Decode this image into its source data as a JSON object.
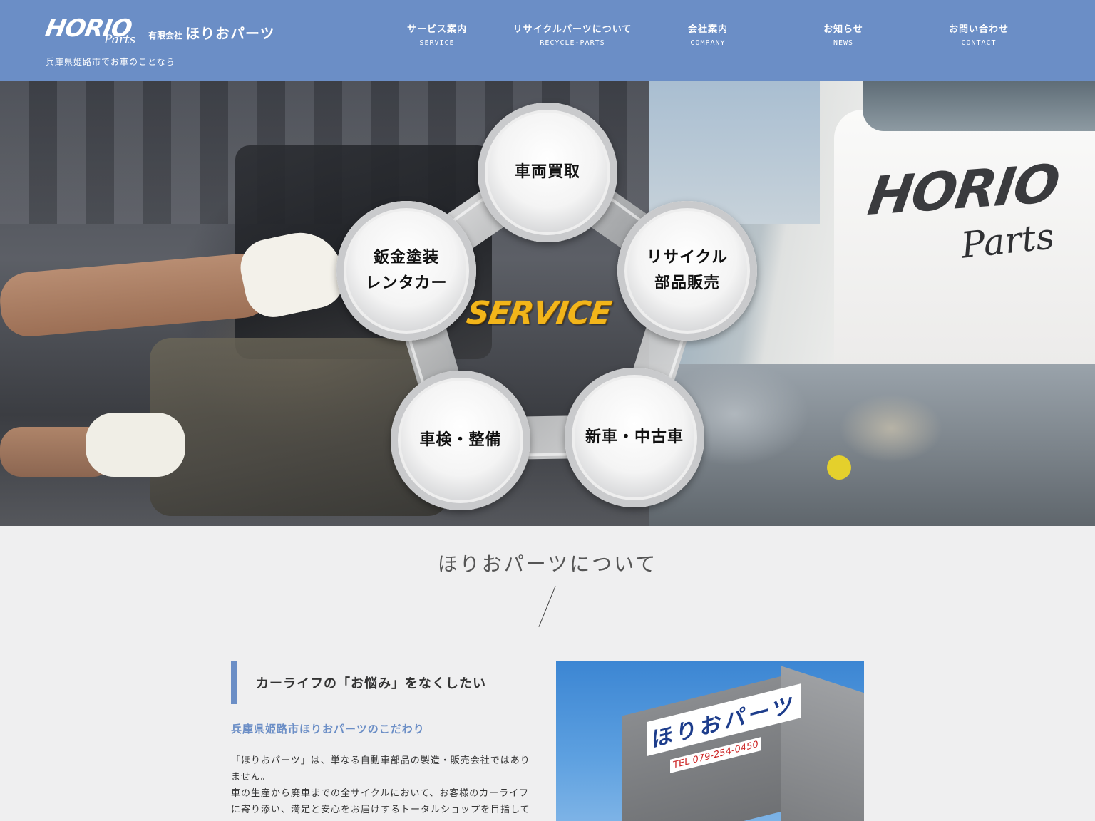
{
  "header": {
    "logo_main": "HORIO",
    "logo_sub": "Parts",
    "company_prefix": "有限会社",
    "company_name": "ほりおパーツ",
    "tagline": "兵庫県姫路市でお車のことなら",
    "bg_color": "#6b8ec6"
  },
  "nav": [
    {
      "jp": "サービス案内",
      "en": "SERVICE"
    },
    {
      "jp": "リサイクルパーツについて",
      "en": "RECYCLE-PARTS"
    },
    {
      "jp": "会社案内",
      "en": "COMPANY"
    },
    {
      "jp": "お知らせ",
      "en": "NEWS"
    },
    {
      "jp": "お問い合わせ",
      "en": "CONTACT"
    }
  ],
  "hero": {
    "center_word": "SERVICE",
    "truck_logo_main": "HORIO",
    "truck_logo_sub": "Parts",
    "services": [
      {
        "line1": "車両買取",
        "line2": ""
      },
      {
        "line1": "リサイクル",
        "line2": "部品販売"
      },
      {
        "line1": "新車・中古車",
        "line2": ""
      },
      {
        "line1": "車検・整備",
        "line2": ""
      },
      {
        "line1": "鈑金塗装",
        "line2": "レンタカー"
      }
    ]
  },
  "about": {
    "title": "ほりおパーツについて",
    "heading": "カーライフの「お悩み」をなくしたい",
    "subheading": "兵庫県姫路市ほりおパーツのこだわり",
    "paragraphs": [
      "「ほりおパーツ」は、単なる自動車部品の製造・販売会社ではありません。",
      "車の生産から廃車までの全サイクルにおいて、お客様のカーライフに寄り添い、満足と安心をお届けするトータルショップを目指して"
    ],
    "photo_sign": "ほりおパーツ",
    "photo_tel": "TEL 079-254-0450",
    "accent_color": "#6b8ec6"
  }
}
